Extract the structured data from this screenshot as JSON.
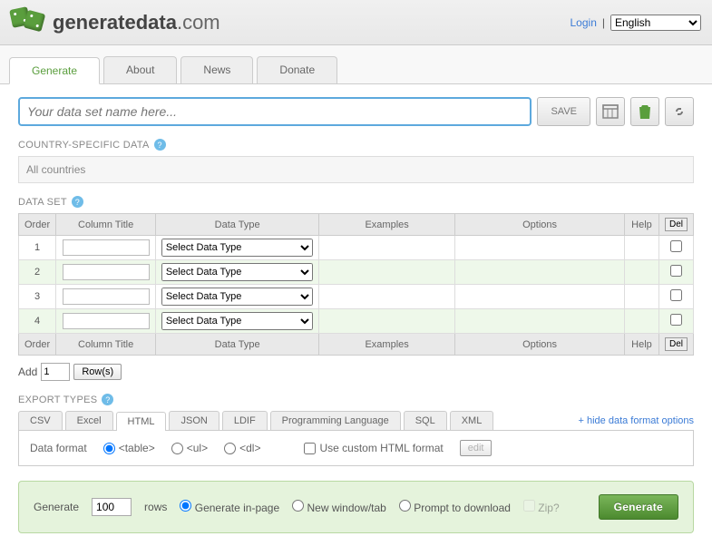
{
  "header": {
    "site_name_bold": "generatedata",
    "site_name_light": ".com",
    "login_link": "Login",
    "lang_selected": "English"
  },
  "nav": {
    "tabs": [
      "Generate",
      "About",
      "News",
      "Donate"
    ],
    "active_index": 0
  },
  "toolbar": {
    "name_placeholder": "Your data set name here...",
    "save_label": "SAVE"
  },
  "country_section": {
    "title": "COUNTRY-SPECIFIC DATA",
    "value": "All countries"
  },
  "dataset": {
    "title": "DATA SET",
    "headers": {
      "order": "Order",
      "column_title": "Column Title",
      "data_type": "Data Type",
      "examples": "Examples",
      "options": "Options",
      "help": "Help",
      "del": "Del"
    },
    "default_type_option": "Select Data Type",
    "rows": [
      {
        "order": "1",
        "title": "",
        "type": "Select Data Type"
      },
      {
        "order": "2",
        "title": "",
        "type": "Select Data Type"
      },
      {
        "order": "3",
        "title": "",
        "type": "Select Data Type"
      },
      {
        "order": "4",
        "title": "",
        "type": "Select Data Type"
      }
    ],
    "add": {
      "label_add": "Add",
      "count": "1",
      "label_rows": "Row(s)"
    }
  },
  "export": {
    "title": "EXPORT TYPES",
    "tabs": [
      "CSV",
      "Excel",
      "HTML",
      "JSON",
      "LDIF",
      "Programming Language",
      "SQL",
      "XML"
    ],
    "active_index": 2,
    "hide_link": "+ hide data format options",
    "html_panel": {
      "label_data_format": "Data format",
      "opt_table": "<table>",
      "opt_ul": "<ul>",
      "opt_dl": "<dl>",
      "custom_label": "Use custom HTML format",
      "edit_btn": "edit"
    }
  },
  "generate": {
    "label_generate": "Generate",
    "count": "100",
    "label_rows": "rows",
    "opt_inpage": "Generate in-page",
    "opt_newtab": "New window/tab",
    "opt_prompt": "Prompt to download",
    "opt_zip": "Zip?",
    "button": "Generate"
  }
}
